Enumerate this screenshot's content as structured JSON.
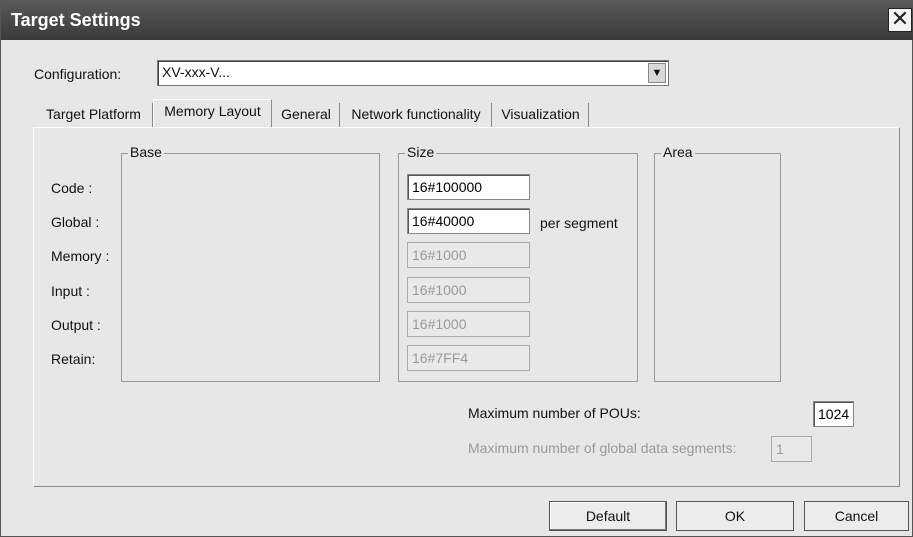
{
  "window": {
    "title": "Target Settings",
    "close_glyph": "✕"
  },
  "configuration": {
    "label": "Configuration:",
    "value": "XV-xxx-V..."
  },
  "tabs": [
    {
      "label": "Target Platform",
      "active": false
    },
    {
      "label": "Memory Layout",
      "active": true
    },
    {
      "label": "General",
      "active": false
    },
    {
      "label": "Network functionality",
      "active": false
    },
    {
      "label": "Visualization",
      "active": false
    }
  ],
  "memory_layout": {
    "groups": {
      "base": "Base",
      "size": "Size",
      "area": "Area"
    },
    "rows": [
      {
        "label": "Code :",
        "size": "16#100000",
        "enabled": true
      },
      {
        "label": "Global :",
        "size": "16#40000",
        "enabled": true
      },
      {
        "label": "Memory :",
        "size": "16#1000",
        "enabled": false
      },
      {
        "label": "Input :",
        "size": "16#1000",
        "enabled": false
      },
      {
        "label": "Output :",
        "size": "16#1000",
        "enabled": false
      },
      {
        "label": "Retain:",
        "size": "16#7FF4",
        "enabled": false
      }
    ],
    "per_segment_label": "per segment",
    "max_pous": {
      "label": "Maximum number of POUs:",
      "value": "1024"
    },
    "max_global_segments": {
      "label": "Maximum number of global data segments:",
      "value": "1",
      "enabled": false
    }
  },
  "buttons": {
    "default": "Default",
    "ok": "OK",
    "cancel": "Cancel"
  },
  "colors": {
    "titlebar": "#4a4a4a",
    "dialog_bg": "#e7e7e7",
    "disabled_text": "#999999"
  }
}
